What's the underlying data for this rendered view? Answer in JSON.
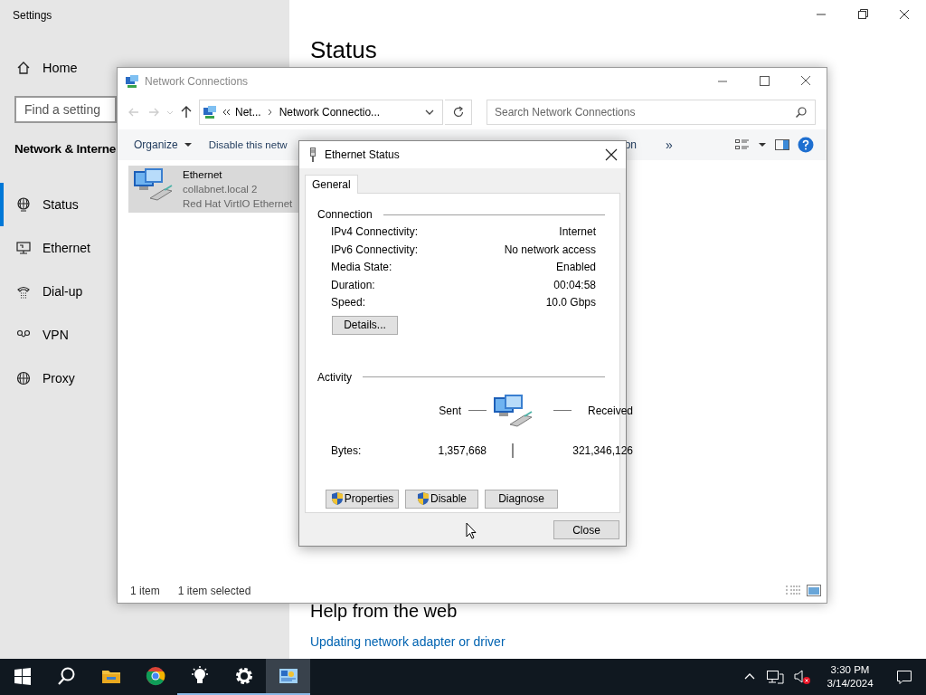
{
  "settings": {
    "title": "Settings",
    "home": "Home",
    "search": {
      "placeholder": "Find a setting"
    },
    "section": "Network & Interne",
    "nav": [
      {
        "label": "Status",
        "kind": "status",
        "selected": true
      },
      {
        "label": "Ethernet",
        "kind": "ethernet",
        "selected": false
      },
      {
        "label": "Dial-up",
        "kind": "dialup",
        "selected": false
      },
      {
        "label": "VPN",
        "kind": "vpn",
        "selected": false
      },
      {
        "label": "Proxy",
        "kind": "proxy",
        "selected": false
      }
    ],
    "heading": "Status",
    "help_heading": "Help from the web",
    "help_link": "Updating network adapter or driver"
  },
  "network_window": {
    "title": "Network Connections",
    "breadcrumb": [
      "Net...",
      "Network Connectio..."
    ],
    "search": {
      "placeholder": "Search Network Connections"
    },
    "toolbar": [
      {
        "label": "Organize",
        "kind": "menu"
      },
      {
        "label": "Disable this netw",
        "kind": "plain"
      },
      {
        "label": "on",
        "kind": "plain"
      },
      {
        "label": "»",
        "kind": "overflow"
      }
    ],
    "items": [
      {
        "name": "Ethernet",
        "domain": "collabnet.local 2",
        "adapter": "Red Hat VirtIO Ethernet",
        "selected": true
      }
    ],
    "status_bar": [
      "1 item",
      "1 item selected"
    ]
  },
  "dialog": {
    "title": "Ethernet Status",
    "tabs": [
      {
        "label": "General",
        "selected": true
      }
    ],
    "connection": {
      "title": "Connection",
      "rows": [
        {
          "label": "IPv4 Connectivity:",
          "value": "Internet"
        },
        {
          "label": "IPv6 Connectivity:",
          "value": "No network access"
        },
        {
          "label": "Media State:",
          "value": "Enabled"
        },
        {
          "label": "Duration:",
          "value": "00:04:58"
        },
        {
          "label": "Speed:",
          "value": "10.0 Gbps"
        }
      ],
      "details_button": "Details..."
    },
    "activity": {
      "title": "Activity",
      "sent_label": "Sent",
      "received_label": "Received",
      "bytes_label": "Bytes:",
      "sent": "1,357,668",
      "received": "321,346,126"
    },
    "buttons": [
      {
        "label": "Properties",
        "shield": true
      },
      {
        "label": "Disable",
        "shield": true
      },
      {
        "label": "Diagnose",
        "shield": false
      }
    ],
    "close_button": "Close"
  },
  "taskbar": {
    "apps": [
      {
        "kind": "start",
        "running": false,
        "selected": false
      },
      {
        "kind": "search",
        "running": false,
        "selected": false
      },
      {
        "kind": "files",
        "running": false,
        "selected": false
      },
      {
        "kind": "browser",
        "running": false,
        "selected": false
      },
      {
        "kind": "bulb",
        "running": true,
        "selected": false
      },
      {
        "kind": "gear",
        "running": true,
        "selected": false
      },
      {
        "kind": "network",
        "running": true,
        "selected": true
      }
    ],
    "time": "3:30 PM",
    "date": "3/14/2024"
  }
}
